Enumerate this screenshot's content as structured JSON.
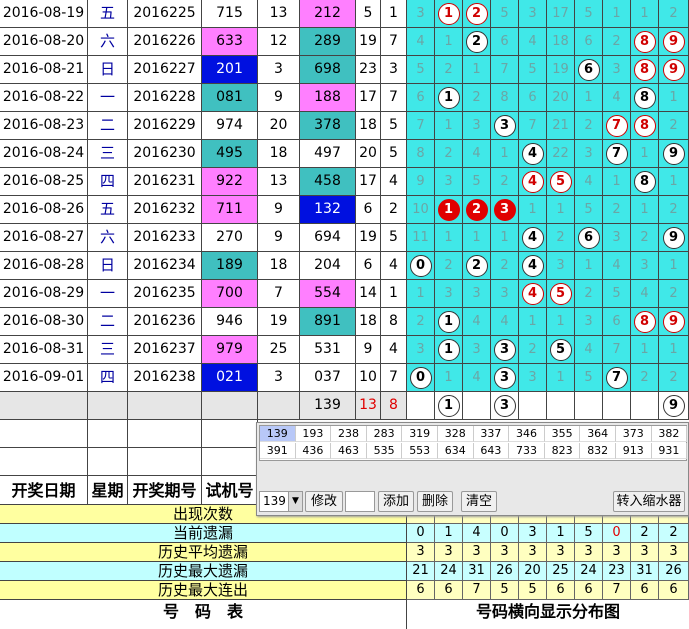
{
  "draw_rows": [
    {
      "date": "2016-08-19",
      "week": "五",
      "period": "2016225",
      "test": "715",
      "sum": "13",
      "test_bg": "",
      "num": "212",
      "num_bg": "magenta",
      "a": "5",
      "b": "1",
      "cells": [
        [
          "3",
          ""
        ],
        [
          "1",
          "r"
        ],
        [
          "2",
          "r"
        ],
        [
          "5",
          ""
        ],
        [
          "3",
          ""
        ],
        [
          "17",
          ""
        ],
        [
          "5",
          ""
        ],
        [
          "1",
          ""
        ],
        [
          "1",
          ""
        ],
        [
          "2",
          ""
        ]
      ]
    },
    {
      "date": "2016-08-20",
      "week": "六",
      "period": "2016226",
      "test": "633",
      "sum": "12",
      "test_bg": "magenta",
      "num": "289",
      "num_bg": "teal",
      "a": "19",
      "b": "7",
      "cells": [
        [
          "4",
          ""
        ],
        [
          "1",
          ""
        ],
        [
          "2",
          "b"
        ],
        [
          "6",
          ""
        ],
        [
          "4",
          ""
        ],
        [
          "18",
          ""
        ],
        [
          "6",
          ""
        ],
        [
          "2",
          ""
        ],
        [
          "8",
          "r"
        ],
        [
          "9",
          "r"
        ]
      ]
    },
    {
      "date": "2016-08-21",
      "week": "日",
      "period": "2016227",
      "test": "201",
      "sum": "3",
      "test_bg": "blue",
      "num": "698",
      "num_bg": "teal",
      "a": "23",
      "b": "3",
      "cells": [
        [
          "5",
          ""
        ],
        [
          "2",
          ""
        ],
        [
          "1",
          ""
        ],
        [
          "7",
          ""
        ],
        [
          "5",
          ""
        ],
        [
          "19",
          ""
        ],
        [
          "6",
          "b"
        ],
        [
          "3",
          ""
        ],
        [
          "8",
          "r"
        ],
        [
          "9",
          "r"
        ]
      ]
    },
    {
      "date": "2016-08-22",
      "week": "一",
      "period": "2016228",
      "test": "081",
      "sum": "9",
      "test_bg": "teal",
      "num": "188",
      "num_bg": "magenta",
      "a": "17",
      "b": "7",
      "cells": [
        [
          "6",
          ""
        ],
        [
          "1",
          "b"
        ],
        [
          "2",
          ""
        ],
        [
          "8",
          ""
        ],
        [
          "6",
          ""
        ],
        [
          "20",
          ""
        ],
        [
          "1",
          ""
        ],
        [
          "4",
          ""
        ],
        [
          "8",
          "b"
        ],
        [
          "1",
          ""
        ]
      ]
    },
    {
      "date": "2016-08-23",
      "week": "二",
      "period": "2016229",
      "test": "974",
      "sum": "20",
      "test_bg": "",
      "num": "378",
      "num_bg": "teal",
      "a": "18",
      "b": "5",
      "cells": [
        [
          "7",
          ""
        ],
        [
          "1",
          ""
        ],
        [
          "3",
          ""
        ],
        [
          "3",
          "b"
        ],
        [
          "7",
          ""
        ],
        [
          "21",
          ""
        ],
        [
          "2",
          ""
        ],
        [
          "7",
          "r"
        ],
        [
          "8",
          "r"
        ],
        [
          "2",
          ""
        ]
      ]
    },
    {
      "date": "2016-08-24",
      "week": "三",
      "period": "2016230",
      "test": "495",
      "sum": "18",
      "test_bg": "teal",
      "num": "497",
      "num_bg": "",
      "a": "20",
      "b": "5",
      "cells": [
        [
          "8",
          ""
        ],
        [
          "2",
          ""
        ],
        [
          "4",
          ""
        ],
        [
          "1",
          ""
        ],
        [
          "4",
          "b"
        ],
        [
          "22",
          ""
        ],
        [
          "3",
          ""
        ],
        [
          "7",
          "b"
        ],
        [
          "1",
          ""
        ],
        [
          "9",
          "b"
        ]
      ]
    },
    {
      "date": "2016-08-25",
      "week": "四",
      "period": "2016231",
      "test": "922",
      "sum": "13",
      "test_bg": "magenta",
      "num": "458",
      "num_bg": "teal",
      "a": "17",
      "b": "4",
      "cells": [
        [
          "9",
          ""
        ],
        [
          "3",
          ""
        ],
        [
          "5",
          ""
        ],
        [
          "2",
          ""
        ],
        [
          "4",
          "r"
        ],
        [
          "5",
          "r"
        ],
        [
          "4",
          ""
        ],
        [
          "1",
          ""
        ],
        [
          "8",
          "b"
        ],
        [
          "1",
          ""
        ]
      ]
    },
    {
      "date": "2016-08-26",
      "week": "五",
      "period": "2016232",
      "test": "711",
      "sum": "9",
      "test_bg": "magenta",
      "num": "132",
      "num_bg": "blue",
      "a": "6",
      "b": "2",
      "cells": [
        [
          "10",
          ""
        ],
        [
          "1",
          "f"
        ],
        [
          "2",
          "f"
        ],
        [
          "3",
          "f"
        ],
        [
          "1",
          ""
        ],
        [
          "1",
          ""
        ],
        [
          "5",
          ""
        ],
        [
          "2",
          ""
        ],
        [
          "1",
          ""
        ],
        [
          "2",
          ""
        ]
      ]
    },
    {
      "date": "2016-08-27",
      "week": "六",
      "period": "2016233",
      "test": "270",
      "sum": "9",
      "test_bg": "",
      "num": "694",
      "num_bg": "",
      "a": "19",
      "b": "5",
      "cells": [
        [
          "11",
          ""
        ],
        [
          "1",
          ""
        ],
        [
          "1",
          ""
        ],
        [
          "1",
          ""
        ],
        [
          "4",
          "b"
        ],
        [
          "2",
          ""
        ],
        [
          "6",
          "b"
        ],
        [
          "3",
          ""
        ],
        [
          "2",
          ""
        ],
        [
          "9",
          "b"
        ]
      ]
    },
    {
      "date": "2016-08-28",
      "week": "日",
      "period": "2016234",
      "test": "189",
      "sum": "18",
      "test_bg": "teal",
      "num": "204",
      "num_bg": "",
      "a": "6",
      "b": "4",
      "cells": [
        [
          "0",
          "b"
        ],
        [
          "2",
          ""
        ],
        [
          "2",
          "b"
        ],
        [
          "2",
          ""
        ],
        [
          "4",
          "b"
        ],
        [
          "3",
          ""
        ],
        [
          "1",
          ""
        ],
        [
          "4",
          ""
        ],
        [
          "3",
          ""
        ],
        [
          "1",
          ""
        ]
      ]
    },
    {
      "date": "2016-08-29",
      "week": "一",
      "period": "2016235",
      "test": "700",
      "sum": "7",
      "test_bg": "magenta",
      "num": "554",
      "num_bg": "magenta",
      "a": "14",
      "b": "1",
      "cells": [
        [
          "1",
          ""
        ],
        [
          "3",
          ""
        ],
        [
          "3",
          ""
        ],
        [
          "3",
          ""
        ],
        [
          "4",
          "r"
        ],
        [
          "5",
          "r"
        ],
        [
          "2",
          ""
        ],
        [
          "5",
          ""
        ],
        [
          "4",
          ""
        ],
        [
          "2",
          ""
        ]
      ]
    },
    {
      "date": "2016-08-30",
      "week": "二",
      "period": "2016236",
      "test": "946",
      "sum": "19",
      "test_bg": "",
      "num": "891",
      "num_bg": "teal",
      "a": "18",
      "b": "8",
      "cells": [
        [
          "2",
          ""
        ],
        [
          "1",
          "b"
        ],
        [
          "4",
          ""
        ],
        [
          "4",
          ""
        ],
        [
          "1",
          ""
        ],
        [
          "1",
          ""
        ],
        [
          "3",
          ""
        ],
        [
          "6",
          ""
        ],
        [
          "8",
          "r"
        ],
        [
          "9",
          "r"
        ]
      ]
    },
    {
      "date": "2016-08-31",
      "week": "三",
      "period": "2016237",
      "test": "979",
      "sum": "25",
      "test_bg": "magenta",
      "num": "531",
      "num_bg": "",
      "a": "9",
      "b": "4",
      "cells": [
        [
          "3",
          ""
        ],
        [
          "1",
          "b"
        ],
        [
          "3",
          ""
        ],
        [
          "3",
          "b"
        ],
        [
          "2",
          ""
        ],
        [
          "5",
          "b"
        ],
        [
          "4",
          ""
        ],
        [
          "7",
          ""
        ],
        [
          "1",
          ""
        ],
        [
          "1",
          ""
        ]
      ]
    },
    {
      "date": "2016-09-01",
      "week": "四",
      "period": "2016238",
      "test": "021",
      "sum": "3",
      "test_bg": "blue",
      "num": "037",
      "num_bg": "",
      "a": "10",
      "b": "7",
      "cells": [
        [
          "0",
          "b"
        ],
        [
          "1",
          ""
        ],
        [
          "4",
          ""
        ],
        [
          "3",
          "b"
        ],
        [
          "3",
          ""
        ],
        [
          "1",
          ""
        ],
        [
          "5",
          ""
        ],
        [
          "7",
          "b"
        ],
        [
          "2",
          ""
        ],
        [
          "2",
          ""
        ]
      ]
    }
  ],
  "prediction_row": {
    "num": "139",
    "a": "13",
    "b": "8",
    "balls": {
      "1": "1",
      "3": "3",
      "9": "9"
    }
  },
  "headers": {
    "date": "开奖日期",
    "week": "星期",
    "period": "开奖期号",
    "test": "试机号"
  },
  "popup": {
    "numbers": [
      "139",
      "193",
      "238",
      "283",
      "319",
      "328",
      "337",
      "346",
      "355",
      "364",
      "373",
      "382",
      "391",
      "436",
      "463",
      "535",
      "553",
      "634",
      "643",
      "733",
      "823",
      "832",
      "913",
      "931"
    ],
    "combo_value": "139",
    "modify_label": "修改",
    "add_label": "添加",
    "delete_label": "删除",
    "clear_label": "清空",
    "transfer_label": "转入缩水器"
  },
  "stats": [
    {
      "label": "出现次数",
      "values": [
        "",
        "",
        "",
        "",
        "",
        "",
        "",
        "",
        "",
        ""
      ],
      "kind": "Y"
    },
    {
      "label": "当前遗漏",
      "values": [
        "0",
        "1",
        "4",
        "0",
        "3",
        "1",
        "5",
        "0",
        "2",
        "2"
      ],
      "kind": "C",
      "red_index": 7
    },
    {
      "label": "历史平均遗漏",
      "values": [
        "3",
        "3",
        "3",
        "3",
        "3",
        "3",
        "3",
        "3",
        "3",
        "3"
      ],
      "kind": "Y"
    },
    {
      "label": "历史最大遗漏",
      "values": [
        "21",
        "24",
        "31",
        "26",
        "20",
        "25",
        "24",
        "23",
        "31",
        "26"
      ],
      "kind": "C"
    },
    {
      "label": "历史最大连出",
      "values": [
        "6",
        "6",
        "7",
        "5",
        "5",
        "6",
        "6",
        "7",
        "6",
        "6"
      ],
      "kind": "Y"
    }
  ],
  "footer": {
    "left": "号　码　表",
    "right": "号码横向显示分布图"
  },
  "colors": {
    "teal": "#40c0c0",
    "magenta": "#ff7fff",
    "blue": "#0010e0",
    "cyan": "#40e8e8",
    "yellow": "#ffffa0"
  }
}
